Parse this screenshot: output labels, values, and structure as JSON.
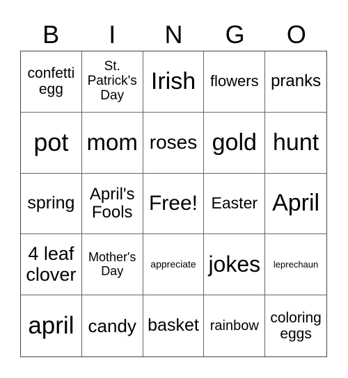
{
  "header": {
    "letters": [
      "B",
      "I",
      "N",
      "G",
      "O"
    ]
  },
  "cells": [
    {
      "text": "confetti egg",
      "size": 21
    },
    {
      "text": "St. Patrick's Day",
      "size": 19
    },
    {
      "text": "Irish",
      "size": 34
    },
    {
      "text": "flowers",
      "size": 22
    },
    {
      "text": "pranks",
      "size": 24
    },
    {
      "text": "pot",
      "size": 36
    },
    {
      "text": "mom",
      "size": 33
    },
    {
      "text": "roses",
      "size": 28
    },
    {
      "text": "gold",
      "size": 34
    },
    {
      "text": "hunt",
      "size": 34
    },
    {
      "text": "spring",
      "size": 25
    },
    {
      "text": "April's Fools",
      "size": 24
    },
    {
      "text": "Free!",
      "size": 30
    },
    {
      "text": "Easter",
      "size": 23
    },
    {
      "text": "April",
      "size": 34
    },
    {
      "text": "4 leaf clover",
      "size": 27
    },
    {
      "text": "Mother's Day",
      "size": 18
    },
    {
      "text": "appreciate",
      "size": 14
    },
    {
      "text": "jokes",
      "size": 32
    },
    {
      "text": "leprechaun",
      "size": 13
    },
    {
      "text": "april",
      "size": 35
    },
    {
      "text": "candy",
      "size": 26
    },
    {
      "text": "basket",
      "size": 25
    },
    {
      "text": "rainbow",
      "size": 20
    },
    {
      "text": "coloring eggs",
      "size": 21
    }
  ]
}
